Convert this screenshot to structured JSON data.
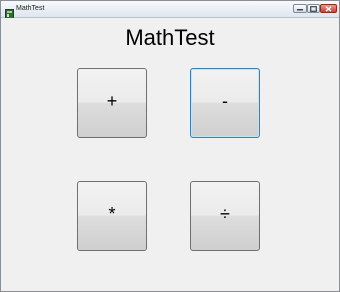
{
  "window": {
    "title": "MathTest",
    "controls": {
      "minimize": "minimize",
      "maximize": "maximize",
      "close": "close"
    }
  },
  "main": {
    "heading": "MathTest",
    "buttons": {
      "add": "+",
      "subtract": "-",
      "multiply": "*",
      "divide": "÷"
    }
  },
  "colors": {
    "close_button": "#c7402c",
    "focus_border": "#3c7fb1"
  }
}
